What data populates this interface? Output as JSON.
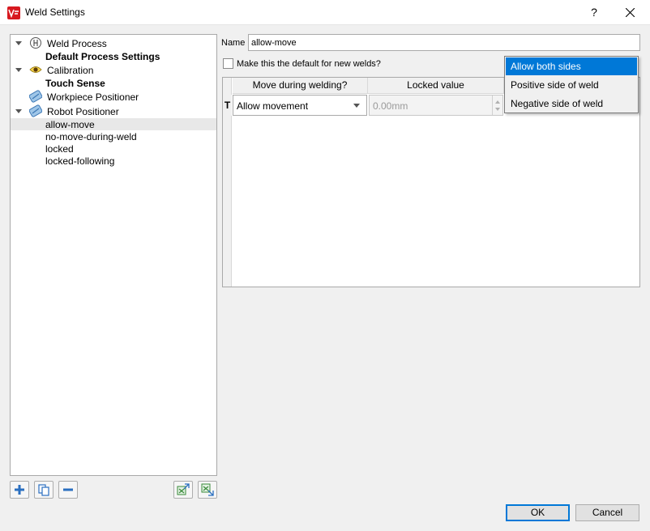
{
  "window": {
    "title": "Weld Settings",
    "help_label": "?",
    "brand_color": "#d71920"
  },
  "tree": {
    "items": [
      {
        "label": "Weld Process",
        "icon": "weld-process-icon",
        "expanded": true
      },
      {
        "label": "Default Process Settings"
      },
      {
        "label": "Calibration",
        "icon": "eye-icon",
        "expanded": true
      },
      {
        "label": "Touch Sense"
      },
      {
        "label": "Workpiece Positioner",
        "icon": "positioner-icon"
      },
      {
        "label": "Robot Positioner",
        "icon": "positioner-icon",
        "expanded": true
      },
      {
        "label": "allow-move",
        "selected": true
      },
      {
        "label": "no-move-during-weld"
      },
      {
        "label": "locked"
      },
      {
        "label": "locked-following"
      }
    ]
  },
  "bottom_buttons": [
    "add-icon",
    "copy-icon",
    "remove-icon",
    "import-icon",
    "export-icon"
  ],
  "form": {
    "name_label": "Name",
    "name_value": "allow-move",
    "default_checkbox_label": "Make this the default for new welds?",
    "default_checked": false
  },
  "table": {
    "columns": [
      "Move during welding?",
      "Locked value"
    ],
    "row_header": "T",
    "row": {
      "move_value": "Allow movement",
      "locked_value": "0.00mm"
    }
  },
  "dropdown": {
    "options": [
      "Allow both sides",
      "Positive side of weld",
      "Negative side of weld"
    ],
    "selected_index": 0,
    "highlight_color": "#0078d7"
  },
  "dialog": {
    "ok_label": "OK",
    "cancel_label": "Cancel"
  }
}
